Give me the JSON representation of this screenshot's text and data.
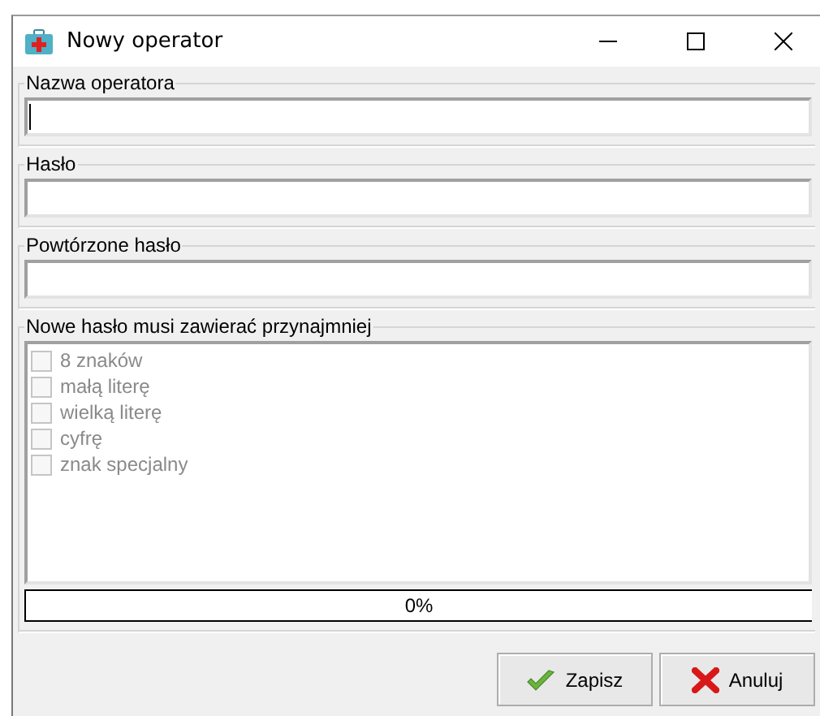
{
  "window": {
    "title": "Nowy operator"
  },
  "fields": [
    {
      "label": "Nazwa operatora",
      "focused": true
    },
    {
      "label": "Hasło",
      "focused": false
    },
    {
      "label": "Powtórzone hasło",
      "focused": false
    }
  ],
  "requirements": {
    "label": "Nowe hasło musi zawierać przynajmniej",
    "items": [
      {
        "label": "8 znaków",
        "checked": false,
        "disabled": true
      },
      {
        "label": "małą literę",
        "checked": false,
        "disabled": true
      },
      {
        "label": "wielką literę",
        "checked": false,
        "disabled": true
      },
      {
        "label": "cyfrę",
        "checked": false,
        "disabled": true
      },
      {
        "label": "znak specjalny",
        "checked": false,
        "disabled": true
      }
    ]
  },
  "strength": {
    "level": 0,
    "reading": "0%"
  },
  "buttons": [
    {
      "kind": "save",
      "label": "Zapisz"
    },
    {
      "kind": "cancel",
      "label": "Anuluj"
    }
  ]
}
